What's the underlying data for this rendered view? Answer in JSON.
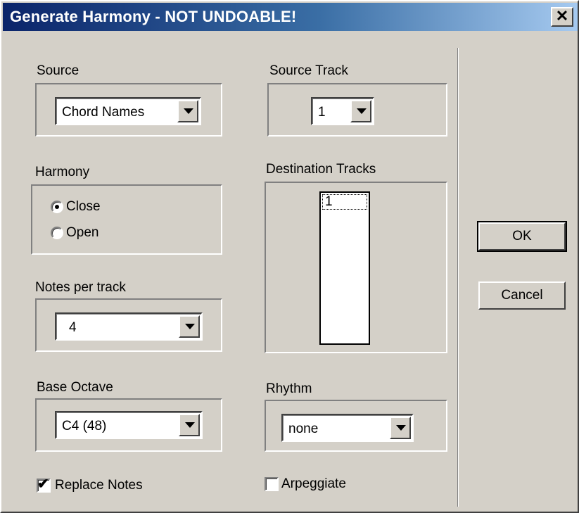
{
  "window": {
    "title": "Generate Harmony - NOT UNDOABLE!",
    "close_glyph": "✕"
  },
  "source": {
    "label": "Source",
    "value": "Chord Names"
  },
  "source_track": {
    "label": "Source Track",
    "value": "1"
  },
  "harmony": {
    "label": "Harmony",
    "options": [
      "Close",
      "Open"
    ],
    "selected": "Close"
  },
  "destination_tracks": {
    "label": "Destination Tracks",
    "items": [
      "1"
    ]
  },
  "notes_per_track": {
    "label": "Notes per track",
    "value": "4"
  },
  "base_octave": {
    "label": "Base Octave",
    "value": "C4 (48)"
  },
  "rhythm": {
    "label": "Rhythm",
    "value": "none"
  },
  "replace_notes": {
    "label": "Replace Notes",
    "checked": true
  },
  "arpeggiate": {
    "label": "Arpeggiate",
    "checked": false
  },
  "buttons": {
    "ok": "OK",
    "cancel": "Cancel"
  },
  "colors": {
    "face": "#d4d0c8",
    "title_start": "#0a246a",
    "title_end": "#a6caf0"
  }
}
